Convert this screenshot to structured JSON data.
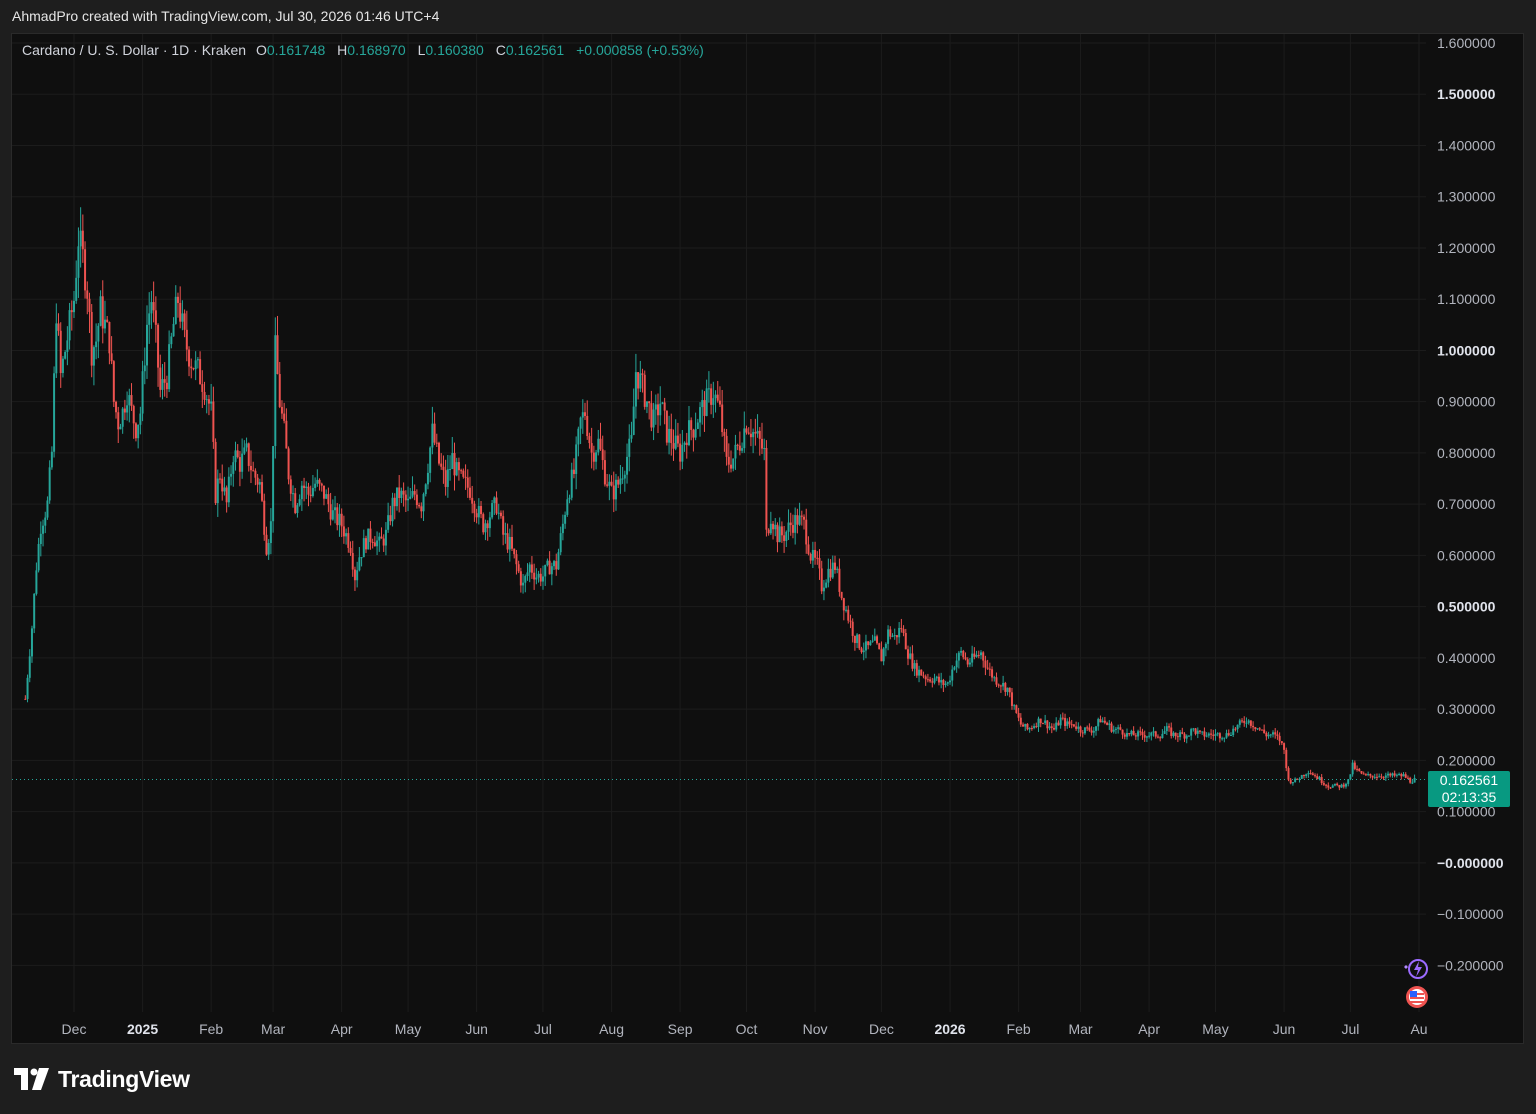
{
  "caption": "AhmadPro created with TradingView.com, Jul 30, 2026 01:46 UTC+4",
  "legend": {
    "symbol": "Cardano / U. S. Dollar · 1D · Kraken",
    "open_label": "O",
    "open": "0.161748",
    "high_label": "H",
    "high": "0.168970",
    "low_label": "L",
    "low": "0.160380",
    "close_label": "C",
    "close": "0.162561",
    "change": "+0.000858 (+0.53%)"
  },
  "price_tag": {
    "price": "0.162561",
    "countdown": "02:13:35"
  },
  "brand": "TradingView",
  "colors": {
    "up": "#26a69a",
    "down": "#ef5350",
    "tag": "#089981",
    "grid": "#1c1c1c"
  },
  "icons": [
    "lightning-icon",
    "us-flag-icon"
  ],
  "chart_data": {
    "type": "candlestick",
    "interval": "1D",
    "ylim": [
      -0.25,
      1.6
    ],
    "y_ticks": [
      {
        "value": 1.6,
        "label": "1.600000",
        "bold": false
      },
      {
        "value": 1.5,
        "label": "1.500000",
        "bold": true
      },
      {
        "value": 1.4,
        "label": "1.400000",
        "bold": false
      },
      {
        "value": 1.3,
        "label": "1.300000",
        "bold": false
      },
      {
        "value": 1.2,
        "label": "1.200000",
        "bold": false
      },
      {
        "value": 1.1,
        "label": "1.100000",
        "bold": false
      },
      {
        "value": 1.0,
        "label": "1.000000",
        "bold": true
      },
      {
        "value": 0.9,
        "label": "0.900000",
        "bold": false
      },
      {
        "value": 0.8,
        "label": "0.800000",
        "bold": false
      },
      {
        "value": 0.7,
        "label": "0.700000",
        "bold": false
      },
      {
        "value": 0.6,
        "label": "0.600000",
        "bold": false
      },
      {
        "value": 0.5,
        "label": "0.500000",
        "bold": true
      },
      {
        "value": 0.4,
        "label": "0.400000",
        "bold": false
      },
      {
        "value": 0.3,
        "label": "0.300000",
        "bold": false
      },
      {
        "value": 0.2,
        "label": "0.200000",
        "bold": false
      },
      {
        "value": 0.1,
        "label": "0.100000",
        "bold": false
      },
      {
        "value": 0.0,
        "label": "−0.000000",
        "bold": true
      },
      {
        "value": -0.1,
        "label": "−0.100000",
        "bold": false
      },
      {
        "value": -0.2,
        "label": "−0.200000",
        "bold": false
      }
    ],
    "x_ticks": [
      {
        "label": "Dec",
        "date": "2024-12-01",
        "bold": false
      },
      {
        "label": "2025",
        "date": "2025-01-01",
        "bold": true
      },
      {
        "label": "Feb",
        "date": "2025-02-01",
        "bold": false
      },
      {
        "label": "Mar",
        "date": "2025-03-01",
        "bold": false
      },
      {
        "label": "Apr",
        "date": "2025-04-01",
        "bold": false
      },
      {
        "label": "May",
        "date": "2025-05-01",
        "bold": false
      },
      {
        "label": "Jun",
        "date": "2025-06-01",
        "bold": false
      },
      {
        "label": "Jul",
        "date": "2025-07-01",
        "bold": false
      },
      {
        "label": "Aug",
        "date": "2025-08-01",
        "bold": false
      },
      {
        "label": "Sep",
        "date": "2025-09-01",
        "bold": false
      },
      {
        "label": "Oct",
        "date": "2025-10-01",
        "bold": false
      },
      {
        "label": "Nov",
        "date": "2025-11-01",
        "bold": false
      },
      {
        "label": "Dec",
        "date": "2025-12-01",
        "bold": false
      },
      {
        "label": "2026",
        "date": "2026-01-01",
        "bold": true
      },
      {
        "label": "Feb",
        "date": "2026-02-01",
        "bold": false
      },
      {
        "label": "Mar",
        "date": "2026-03-01",
        "bold": false
      },
      {
        "label": "Apr",
        "date": "2026-04-01",
        "bold": false
      },
      {
        "label": "May",
        "date": "2026-05-01",
        "bold": false
      },
      {
        "label": "Jun",
        "date": "2026-06-01",
        "bold": false
      },
      {
        "label": "Jul",
        "date": "2026-07-01",
        "bold": false
      },
      {
        "label": "Au",
        "date": "2026-08-01",
        "bold": false
      }
    ],
    "last_price": 0.162561,
    "close_path": [
      [
        "2024-11-09",
        0.32
      ],
      [
        "2024-11-12",
        0.46
      ],
      [
        "2024-11-14",
        0.58
      ],
      [
        "2024-11-16",
        0.66
      ],
      [
        "2024-11-19",
        0.7
      ],
      [
        "2024-11-21",
        0.8
      ],
      [
        "2024-11-23",
        1.08
      ],
      [
        "2024-11-25",
        0.95
      ],
      [
        "2024-11-27",
        1.0
      ],
      [
        "2024-11-29",
        1.05
      ],
      [
        "2024-12-01",
        1.1
      ],
      [
        "2024-12-03",
        1.22
      ],
      [
        "2024-12-05",
        1.18
      ],
      [
        "2024-12-07",
        1.12
      ],
      [
        "2024-12-09",
        1.0
      ],
      [
        "2024-12-11",
        1.02
      ],
      [
        "2024-12-13",
        1.08
      ],
      [
        "2024-12-15",
        1.05
      ],
      [
        "2024-12-17",
        1.02
      ],
      [
        "2024-12-19",
        0.9
      ],
      [
        "2024-12-21",
        0.86
      ],
      [
        "2024-12-23",
        0.88
      ],
      [
        "2024-12-25",
        0.92
      ],
      [
        "2024-12-27",
        0.88
      ],
      [
        "2024-12-29",
        0.85
      ],
      [
        "2024-12-31",
        0.88
      ],
      [
        "2025-01-03",
        1.05
      ],
      [
        "2025-01-05",
        1.1
      ],
      [
        "2025-01-07",
        1.02
      ],
      [
        "2025-01-09",
        0.92
      ],
      [
        "2025-01-12",
        0.95
      ],
      [
        "2025-01-15",
        1.05
      ],
      [
        "2025-01-17",
        1.1
      ],
      [
        "2025-01-20",
        1.02
      ],
      [
        "2025-01-23",
        0.98
      ],
      [
        "2025-01-26",
        0.96
      ],
      [
        "2025-01-29",
        0.93
      ],
      [
        "2025-02-01",
        0.88
      ],
      [
        "2025-02-03",
        0.72
      ],
      [
        "2025-02-05",
        0.76
      ],
      [
        "2025-02-08",
        0.7
      ],
      [
        "2025-02-11",
        0.8
      ],
      [
        "2025-02-14",
        0.78
      ],
      [
        "2025-02-17",
        0.8
      ],
      [
        "2025-02-20",
        0.76
      ],
      [
        "2025-02-23",
        0.74
      ],
      [
        "2025-02-26",
        0.62
      ],
      [
        "2025-02-28",
        0.66
      ],
      [
        "2025-03-02",
        1.0
      ],
      [
        "2025-03-04",
        0.9
      ],
      [
        "2025-03-06",
        0.84
      ],
      [
        "2025-03-08",
        0.76
      ],
      [
        "2025-03-11",
        0.7
      ],
      [
        "2025-03-14",
        0.74
      ],
      [
        "2025-03-17",
        0.72
      ],
      [
        "2025-03-20",
        0.74
      ],
      [
        "2025-03-24",
        0.72
      ],
      [
        "2025-03-28",
        0.68
      ],
      [
        "2025-04-01",
        0.66
      ],
      [
        "2025-04-05",
        0.62
      ],
      [
        "2025-04-07",
        0.56
      ],
      [
        "2025-04-09",
        0.6
      ],
      [
        "2025-04-12",
        0.63
      ],
      [
        "2025-04-15",
        0.64
      ],
      [
        "2025-04-18",
        0.62
      ],
      [
        "2025-04-21",
        0.64
      ],
      [
        "2025-04-24",
        0.7
      ],
      [
        "2025-04-27",
        0.72
      ],
      [
        "2025-05-01",
        0.7
      ],
      [
        "2025-05-04",
        0.72
      ],
      [
        "2025-05-07",
        0.7
      ],
      [
        "2025-05-10",
        0.78
      ],
      [
        "2025-05-12",
        0.84
      ],
      [
        "2025-05-15",
        0.78
      ],
      [
        "2025-05-18",
        0.74
      ],
      [
        "2025-05-21",
        0.79
      ],
      [
        "2025-05-23",
        0.76
      ],
      [
        "2025-05-26",
        0.74
      ],
      [
        "2025-05-29",
        0.73
      ],
      [
        "2025-06-01",
        0.69
      ],
      [
        "2025-06-04",
        0.66
      ],
      [
        "2025-06-07",
        0.68
      ],
      [
        "2025-06-10",
        0.7
      ],
      [
        "2025-06-13",
        0.64
      ],
      [
        "2025-06-16",
        0.62
      ],
      [
        "2025-06-19",
        0.58
      ],
      [
        "2025-06-22",
        0.54
      ],
      [
        "2025-06-25",
        0.58
      ],
      [
        "2025-06-28",
        0.56
      ],
      [
        "2025-07-01",
        0.56
      ],
      [
        "2025-07-04",
        0.58
      ],
      [
        "2025-07-07",
        0.58
      ],
      [
        "2025-07-10",
        0.66
      ],
      [
        "2025-07-12",
        0.72
      ],
      [
        "2025-07-15",
        0.76
      ],
      [
        "2025-07-18",
        0.86
      ],
      [
        "2025-07-20",
        0.88
      ],
      [
        "2025-07-23",
        0.8
      ],
      [
        "2025-07-26",
        0.82
      ],
      [
        "2025-07-29",
        0.76
      ],
      [
        "2025-08-01",
        0.72
      ],
      [
        "2025-08-04",
        0.74
      ],
      [
        "2025-08-07",
        0.78
      ],
      [
        "2025-08-10",
        0.82
      ],
      [
        "2025-08-12",
        0.96
      ],
      [
        "2025-08-14",
        0.94
      ],
      [
        "2025-08-17",
        0.9
      ],
      [
        "2025-08-20",
        0.86
      ],
      [
        "2025-08-23",
        0.9
      ],
      [
        "2025-08-26",
        0.84
      ],
      [
        "2025-08-29",
        0.82
      ],
      [
        "2025-09-01",
        0.8
      ],
      [
        "2025-09-04",
        0.84
      ],
      [
        "2025-09-07",
        0.85
      ],
      [
        "2025-09-10",
        0.88
      ],
      [
        "2025-09-13",
        0.9
      ],
      [
        "2025-09-16",
        0.92
      ],
      [
        "2025-09-19",
        0.88
      ],
      [
        "2025-09-22",
        0.78
      ],
      [
        "2025-09-25",
        0.79
      ],
      [
        "2025-09-28",
        0.82
      ],
      [
        "2025-10-01",
        0.86
      ],
      [
        "2025-10-04",
        0.84
      ],
      [
        "2025-10-07",
        0.82
      ],
      [
        "2025-10-09",
        0.8
      ],
      [
        "2025-10-10",
        0.64
      ],
      [
        "2025-10-12",
        0.68
      ],
      [
        "2025-10-15",
        0.64
      ],
      [
        "2025-10-18",
        0.64
      ],
      [
        "2025-10-21",
        0.66
      ],
      [
        "2025-10-24",
        0.67
      ],
      [
        "2025-10-27",
        0.66
      ],
      [
        "2025-10-30",
        0.6
      ],
      [
        "2025-11-02",
        0.58
      ],
      [
        "2025-11-04",
        0.54
      ],
      [
        "2025-11-07",
        0.57
      ],
      [
        "2025-11-10",
        0.58
      ],
      [
        "2025-11-13",
        0.52
      ],
      [
        "2025-11-16",
        0.48
      ],
      [
        "2025-11-19",
        0.44
      ],
      [
        "2025-11-22",
        0.42
      ],
      [
        "2025-11-25",
        0.42
      ],
      [
        "2025-11-28",
        0.43
      ],
      [
        "2025-12-01",
        0.4
      ],
      [
        "2025-12-04",
        0.45
      ],
      [
        "2025-12-07",
        0.44
      ],
      [
        "2025-12-10",
        0.46
      ],
      [
        "2025-12-13",
        0.41
      ],
      [
        "2025-12-16",
        0.38
      ],
      [
        "2025-12-19",
        0.37
      ],
      [
        "2025-12-22",
        0.36
      ],
      [
        "2025-12-25",
        0.36
      ],
      [
        "2025-12-28",
        0.35
      ],
      [
        "2025-12-31",
        0.35
      ],
      [
        "2026-01-03",
        0.39
      ],
      [
        "2026-01-06",
        0.41
      ],
      [
        "2026-01-09",
        0.39
      ],
      [
        "2026-01-12",
        0.4
      ],
      [
        "2026-01-15",
        0.41
      ],
      [
        "2026-01-18",
        0.38
      ],
      [
        "2026-01-21",
        0.36
      ],
      [
        "2026-01-24",
        0.35
      ],
      [
        "2026-01-27",
        0.34
      ],
      [
        "2026-01-30",
        0.3
      ],
      [
        "2026-02-02",
        0.27
      ],
      [
        "2026-02-05",
        0.26
      ],
      [
        "2026-02-08",
        0.27
      ],
      [
        "2026-02-11",
        0.28
      ],
      [
        "2026-02-14",
        0.27
      ],
      [
        "2026-02-17",
        0.26
      ],
      [
        "2026-02-20",
        0.28
      ],
      [
        "2026-02-23",
        0.27
      ],
      [
        "2026-02-26",
        0.27
      ],
      [
        "2026-03-01",
        0.26
      ],
      [
        "2026-03-04",
        0.26
      ],
      [
        "2026-03-07",
        0.26
      ],
      [
        "2026-03-10",
        0.28
      ],
      [
        "2026-03-13",
        0.27
      ],
      [
        "2026-03-16",
        0.26
      ],
      [
        "2026-03-19",
        0.26
      ],
      [
        "2026-03-22",
        0.25
      ],
      [
        "2026-03-25",
        0.25
      ],
      [
        "2026-03-28",
        0.25
      ],
      [
        "2026-03-31",
        0.25
      ],
      [
        "2026-04-03",
        0.25
      ],
      [
        "2026-04-06",
        0.25
      ],
      [
        "2026-04-09",
        0.26
      ],
      [
        "2026-04-12",
        0.25
      ],
      [
        "2026-04-15",
        0.25
      ],
      [
        "2026-04-18",
        0.25
      ],
      [
        "2026-04-21",
        0.26
      ],
      [
        "2026-04-24",
        0.25
      ],
      [
        "2026-04-27",
        0.25
      ],
      [
        "2026-04-30",
        0.25
      ],
      [
        "2026-05-03",
        0.25
      ],
      [
        "2026-05-06",
        0.25
      ],
      [
        "2026-05-09",
        0.26
      ],
      [
        "2026-05-12",
        0.27
      ],
      [
        "2026-05-15",
        0.28
      ],
      [
        "2026-05-18",
        0.27
      ],
      [
        "2026-05-21",
        0.26
      ],
      [
        "2026-05-24",
        0.25
      ],
      [
        "2026-05-27",
        0.25
      ],
      [
        "2026-05-30",
        0.24
      ],
      [
        "2026-06-01",
        0.22
      ],
      [
        "2026-06-03",
        0.16
      ],
      [
        "2026-06-06",
        0.16
      ],
      [
        "2026-06-09",
        0.17
      ],
      [
        "2026-06-12",
        0.18
      ],
      [
        "2026-06-15",
        0.17
      ],
      [
        "2026-06-18",
        0.16
      ],
      [
        "2026-06-21",
        0.15
      ],
      [
        "2026-06-24",
        0.15
      ],
      [
        "2026-06-27",
        0.15
      ],
      [
        "2026-06-30",
        0.16
      ],
      [
        "2026-07-02",
        0.19
      ],
      [
        "2026-07-04",
        0.18
      ],
      [
        "2026-07-07",
        0.17
      ],
      [
        "2026-07-10",
        0.17
      ],
      [
        "2026-07-13",
        0.17
      ],
      [
        "2026-07-16",
        0.17
      ],
      [
        "2026-07-19",
        0.17
      ],
      [
        "2026-07-22",
        0.17
      ],
      [
        "2026-07-25",
        0.17
      ],
      [
        "2026-07-28",
        0.16
      ],
      [
        "2026-07-30",
        0.162561
      ]
    ]
  }
}
